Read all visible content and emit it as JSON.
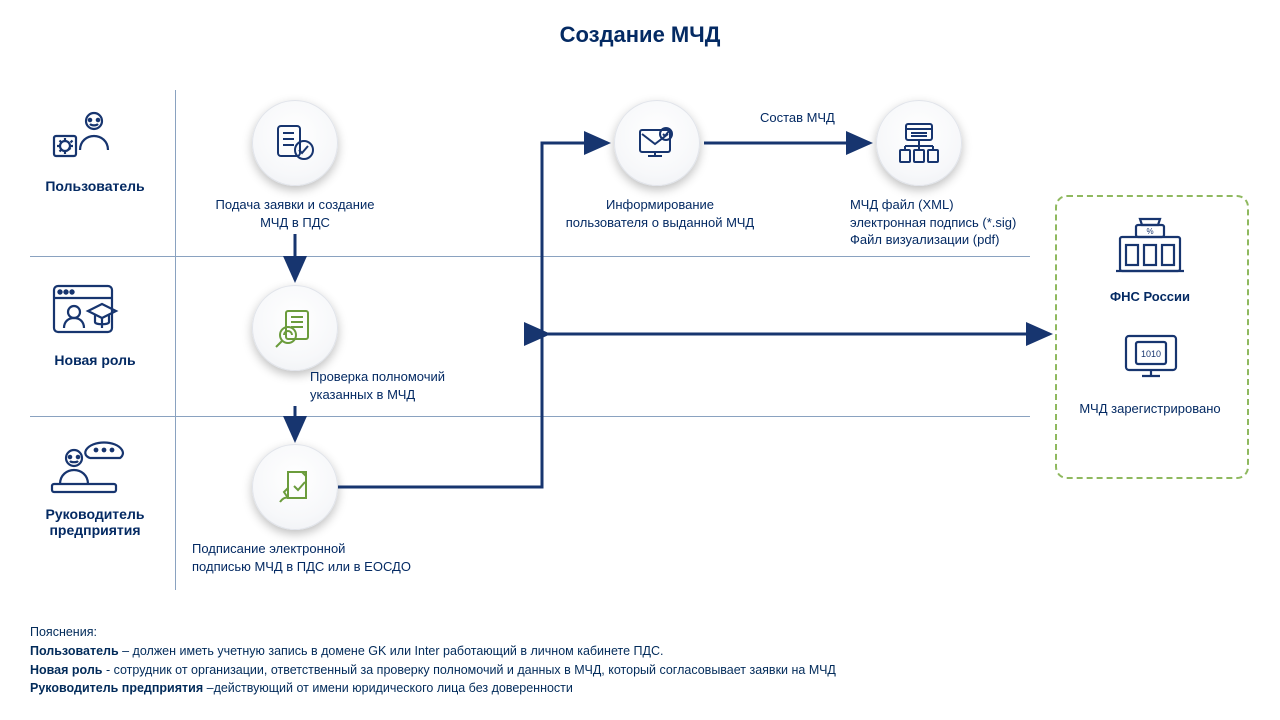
{
  "title": "Создание МЧД",
  "lanes": {
    "user": {
      "label": "Пользователь"
    },
    "newrole": {
      "label": "Новая роль"
    },
    "manager": {
      "label_l1": "Руководитель",
      "label_l2": "предприятия"
    }
  },
  "nodes": {
    "submit": {
      "label_l1": "Подача заявки и создание",
      "label_l2": "МЧД в ПДС"
    },
    "check": {
      "label_l1": "Проверка полномочий",
      "label_l2": "указанных в МЧД"
    },
    "sign": {
      "label_l1": "Подписание электронной",
      "label_l2": "подписью МЧД в ПДС или в ЕОСДО"
    },
    "inform": {
      "label_l1": "Информирование",
      "label_l2": "пользователя о выданной МЧД"
    },
    "package": {
      "arrow_label": "Состав МЧД",
      "label_l1": "МЧД файл (XML)",
      "label_l2": "электронная подпись (*.sig)",
      "label_l3": "Файл визуализации (pdf)"
    }
  },
  "fns": {
    "title": "ФНС России",
    "sub": "МЧД зарегистрировано"
  },
  "notes": {
    "heading": "Пояснения:",
    "user_b": "Пользователь",
    "user_t": " – должен иметь учетную запись в домене GK или Inter работающий в личном кабинете ПДС.",
    "role_b": "Новая роль",
    "role_t": " - сотрудник от организации, ответственный за проверку полномочий и данных в МЧД, который согласовывает заявки на МЧД",
    "mgr_b": "Руководитель предприятия",
    "mgr_t": " –действующий от имени юридического лица без доверенности"
  }
}
